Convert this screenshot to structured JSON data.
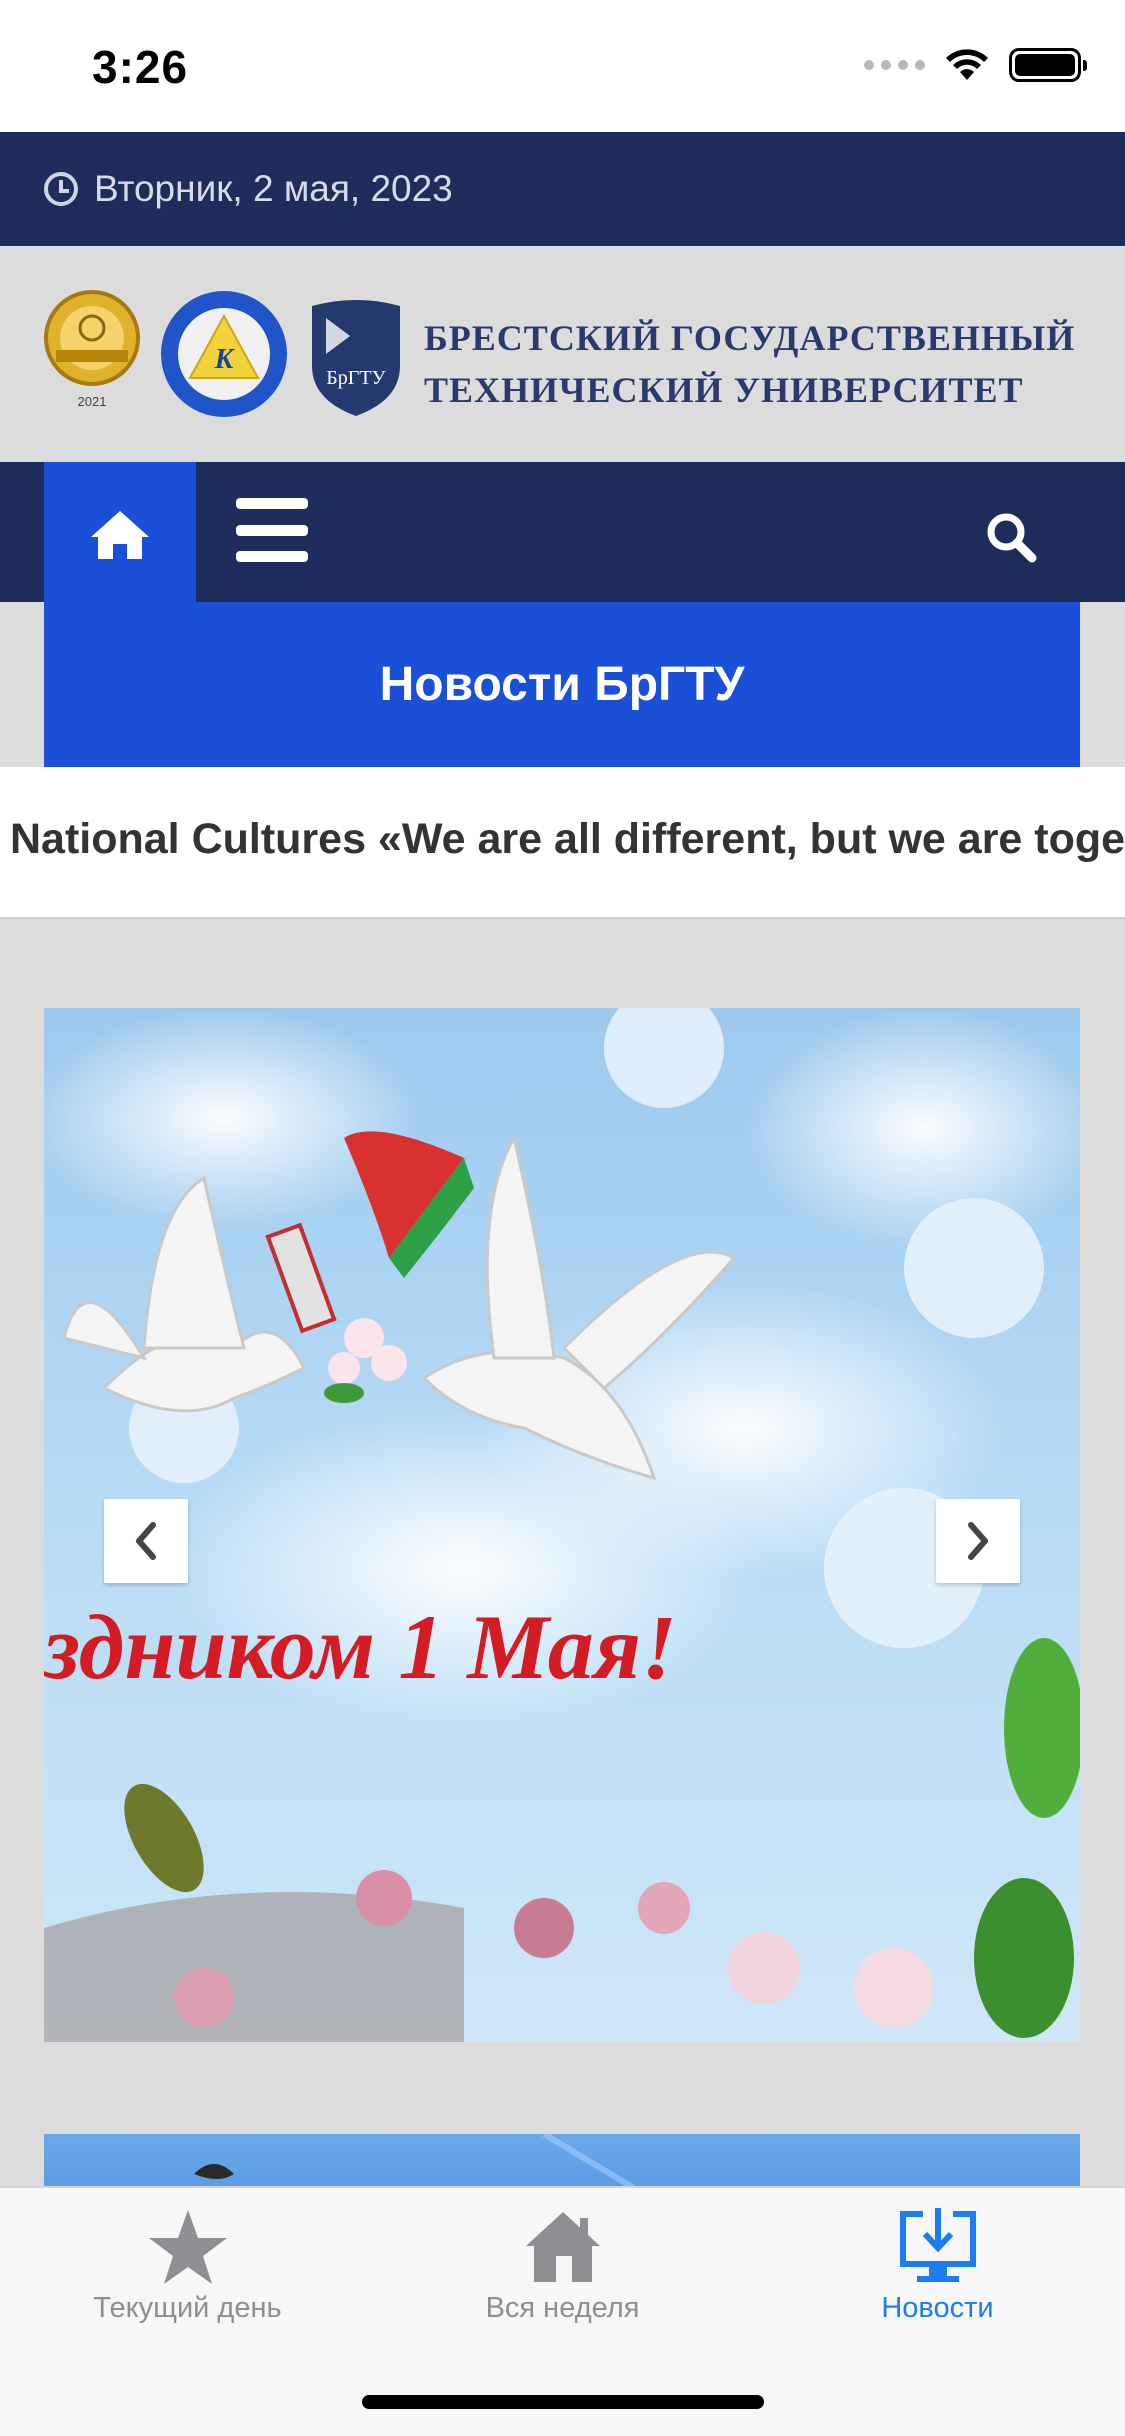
{
  "status_bar": {
    "time": "3:26"
  },
  "header": {
    "date": "Вторник, 2 мая, 2023"
  },
  "logos": {
    "university_name_line1": "БРЕСТСКИЙ ГОСУДАРСТВЕННЫЙ",
    "university_name_line2": "ТЕХНИЧЕСКИЙ УНИВЕРСИТЕТ",
    "award1_year": "2021",
    "award2_letter": "K",
    "shield_abbr": "БрГТУ"
  },
  "nav": {
    "home_icon": "home-icon",
    "menu_icon": "hamburger-icon",
    "search_icon": "search-icon"
  },
  "page_title": "Новости БрГТУ",
  "ticker": {
    "text": "National Cultures «We are all different, but we are together"
  },
  "slider": {
    "caption": "здником 1 Мая!",
    "prev_icon": "chevron-left-icon",
    "next_icon": "chevron-right-icon"
  },
  "tabbar": {
    "tabs": [
      {
        "label": "Текущий день",
        "icon": "star-icon",
        "active": false
      },
      {
        "label": "Вся неделя",
        "icon": "house-icon",
        "active": false
      },
      {
        "label": "Новости",
        "icon": "download-monitor-icon",
        "active": true
      }
    ]
  },
  "colors": {
    "navy": "#1f2d5c",
    "blue": "#1a4fd8",
    "active_tab": "#1a7ef0",
    "inactive_tab": "#8e8e93"
  }
}
